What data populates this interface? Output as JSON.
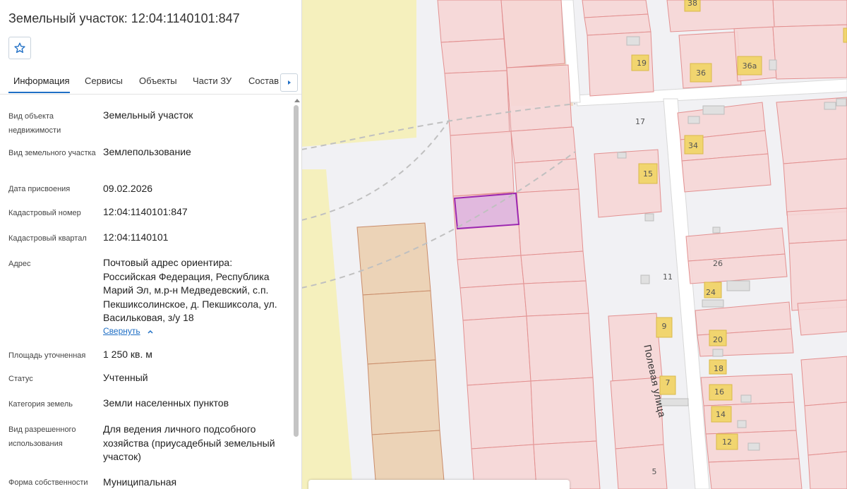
{
  "title": "Земельный участок: 12:04:1140101:847",
  "favorite_icon": "star-icon",
  "tabs": [
    "Информация",
    "Сервисы",
    "Объекты",
    "Части ЗУ",
    "Состав"
  ],
  "fields": [
    {
      "label": "Вид объекта недвижимости",
      "value": "Земельный участок"
    },
    {
      "label": "Вид земельного участка",
      "value": "Землепользование"
    },
    {
      "label": "Дата присвоения",
      "value": "09.02.2026"
    },
    {
      "label": "Кадастровый номер",
      "value": "12:04:1140101:847"
    },
    {
      "label": "Кадастровый квартал",
      "value": "12:04:1140101"
    },
    {
      "label": "Адрес",
      "value": "Почтовый адрес ориентира: Российская Федерация, Республика Марий Эл, м.р-н Медведевский, с.п. Пекшиксолинское, д. Пекшиксола, ул. Васильковая, з/у 18"
    },
    {
      "label": "Площадь уточненная",
      "value": "1 250 кв. м"
    },
    {
      "label": "Статус",
      "value": "Учтенный"
    },
    {
      "label": "Категория земель",
      "value": "Земли населенных пунктов"
    },
    {
      "label": "Вид разрешенного использования",
      "value": "Для ведения личного подсобного хозяйства (приусадебный земельный участок)"
    },
    {
      "label": "Форма собственности",
      "value": "Муниципальная"
    }
  ],
  "collapse_link": "Свернуть",
  "map": {
    "street_label": "Полевая улица",
    "house_numbers": [
      "38",
      "19",
      "36",
      "36а",
      "17",
      "34",
      "15",
      "26",
      "11",
      "24",
      "9",
      "20",
      "18",
      "7",
      "16",
      "14",
      "12",
      "5"
    ],
    "colors": {
      "parcel_fill": "#f6d6d6",
      "parcel_stroke": "#e29090",
      "selected_parcel": "#9c27b0",
      "building": "#f1d56f"
    }
  }
}
